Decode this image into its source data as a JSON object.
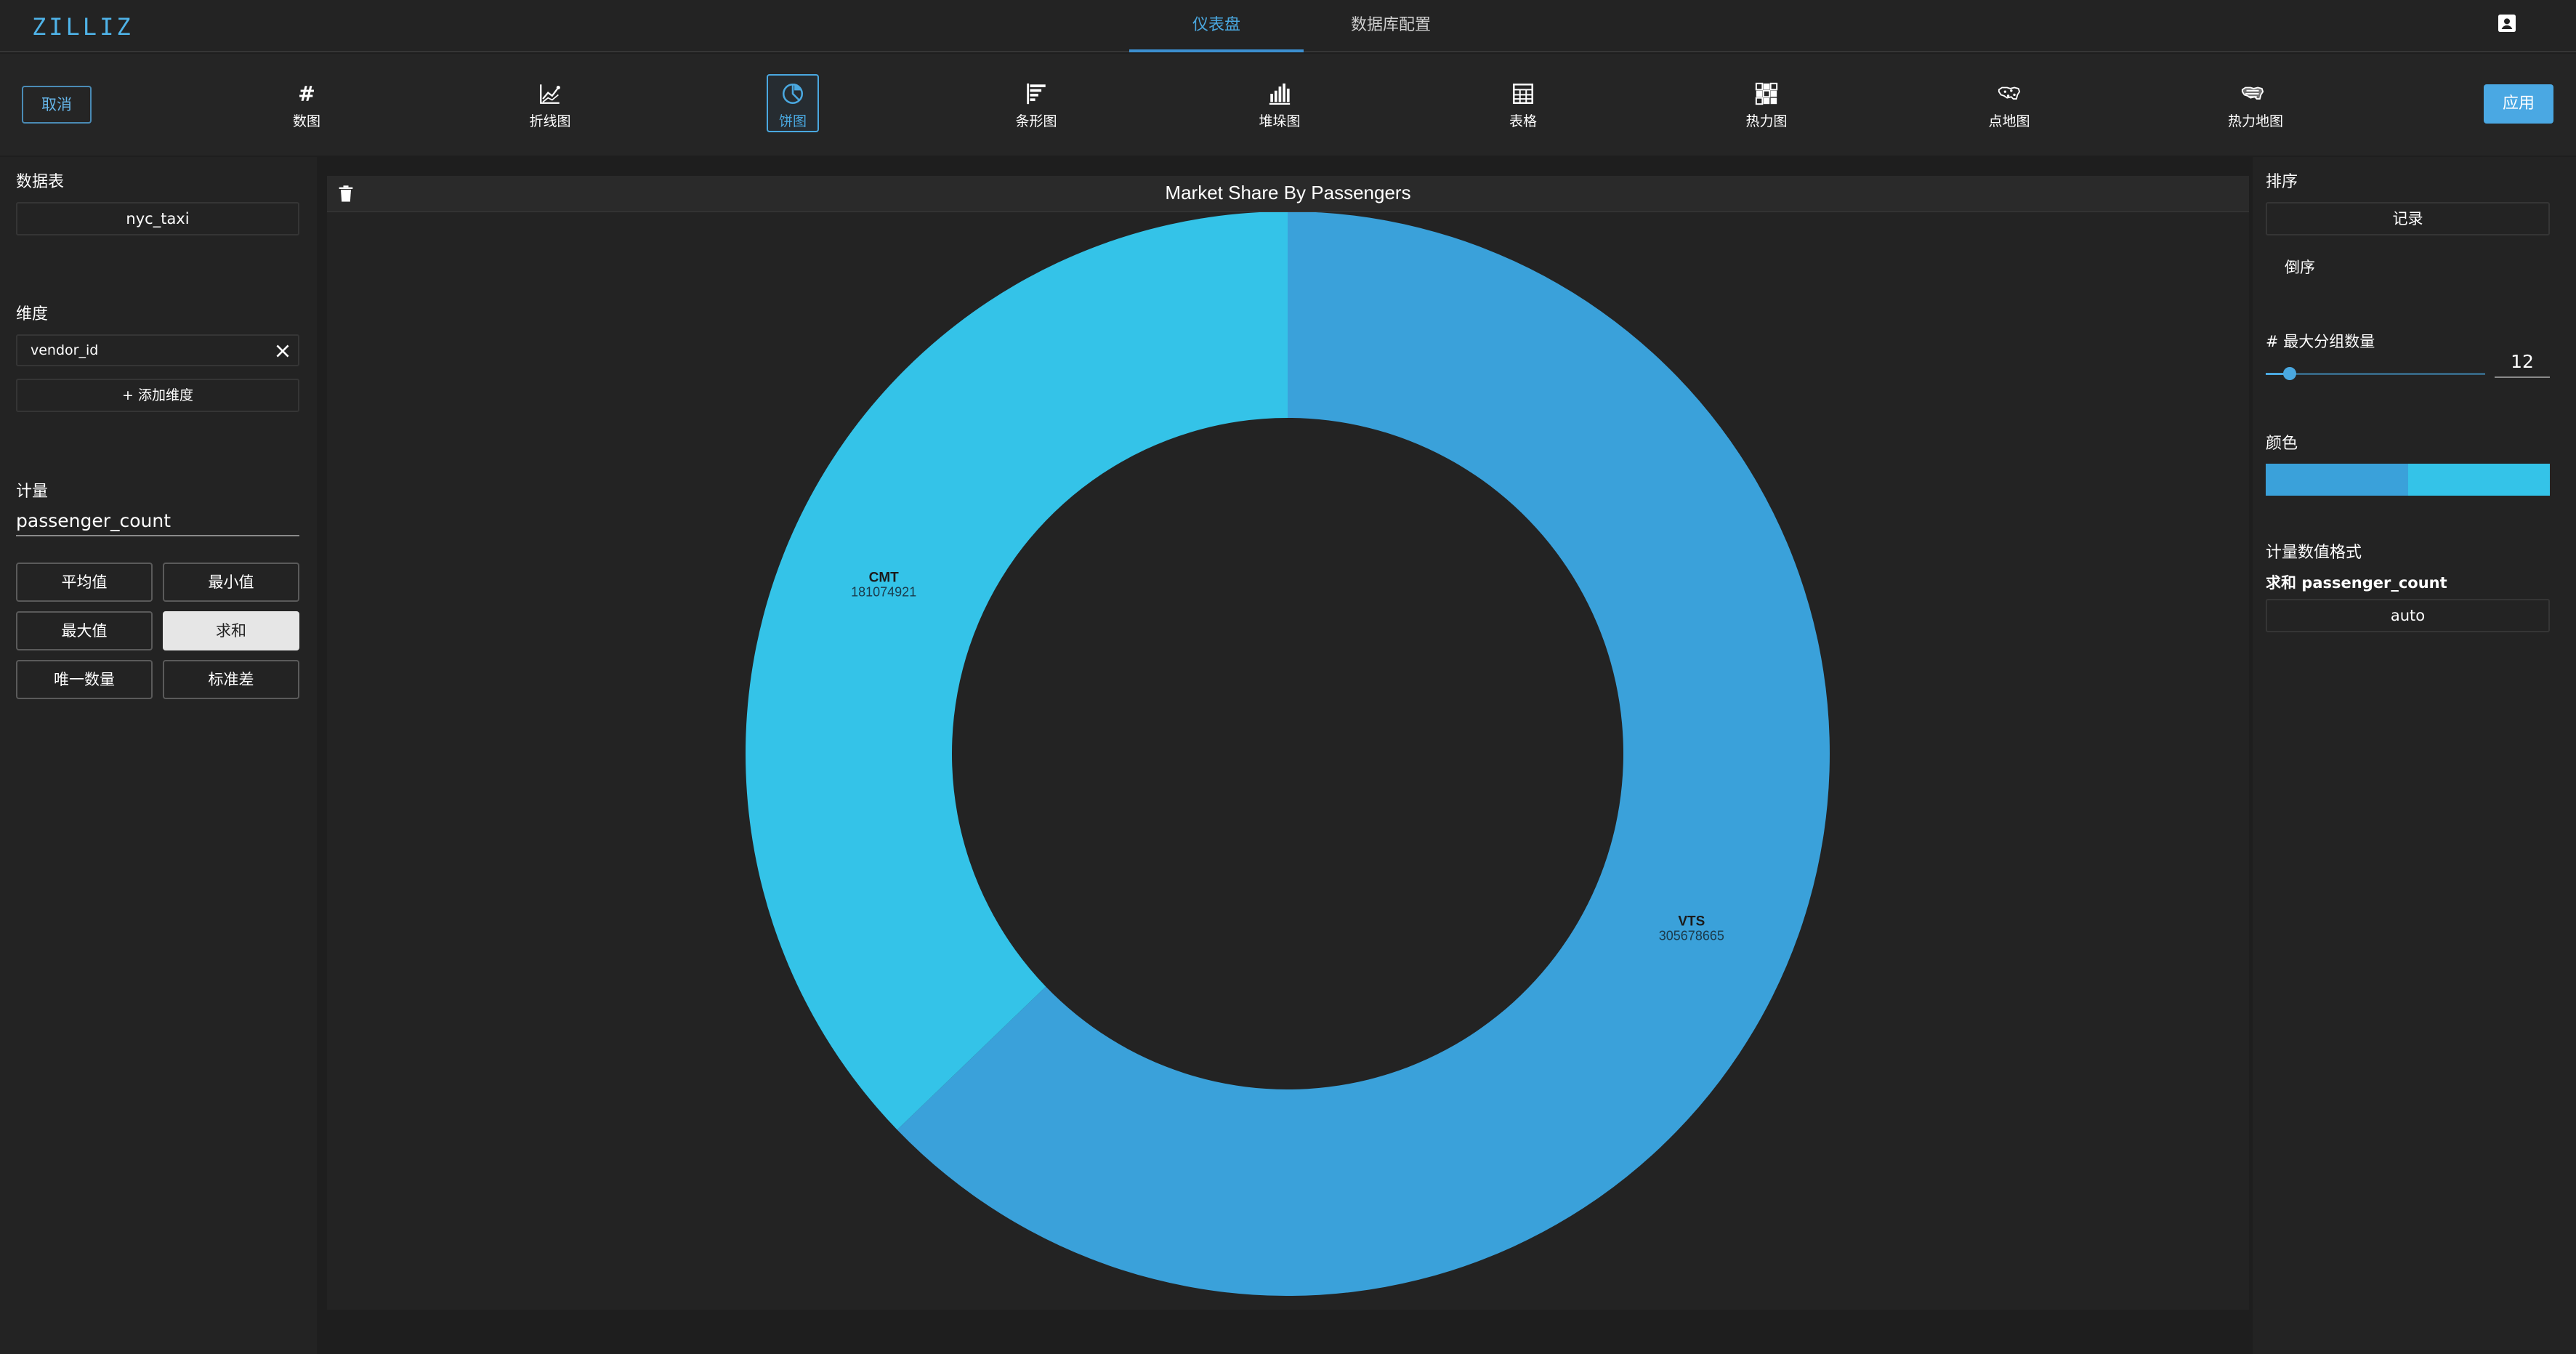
{
  "header": {
    "logo": "ZILLIZ",
    "tabs": [
      {
        "label": "仪表盘",
        "active": true
      },
      {
        "label": "数据库配置",
        "active": false
      }
    ],
    "user_icon": "account-box-icon"
  },
  "toolbar": {
    "cancel_label": "取消",
    "apply_label": "应用",
    "chart_types": [
      {
        "label": "数图",
        "icon": "hash-icon",
        "selected": false
      },
      {
        "label": "折线图",
        "icon": "line-chart-icon",
        "selected": false
      },
      {
        "label": "饼图",
        "icon": "pie-chart-icon",
        "selected": true
      },
      {
        "label": "条形图",
        "icon": "bar-chart-icon",
        "selected": false
      },
      {
        "label": "堆垛图",
        "icon": "stacked-chart-icon",
        "selected": false
      },
      {
        "label": "表格",
        "icon": "table-icon",
        "selected": false
      },
      {
        "label": "热力图",
        "icon": "heatmap-icon",
        "selected": false
      },
      {
        "label": "点地图",
        "icon": "point-map-icon",
        "selected": false
      },
      {
        "label": "热力地图",
        "icon": "heat-map-icon",
        "selected": false
      }
    ]
  },
  "left_panel": {
    "table_title": "数据表",
    "table_value": "nyc_taxi",
    "dimension_title": "维度",
    "dimension_value": "vendor_id",
    "add_dimension_label": "+ 添加维度",
    "measure_title": "计量",
    "measure_value": "passenger_count",
    "aggregations": [
      {
        "label": "平均值",
        "selected": false
      },
      {
        "label": "最小值",
        "selected": false
      },
      {
        "label": "最大值",
        "selected": false
      },
      {
        "label": "求和",
        "selected": true
      },
      {
        "label": "唯一数量",
        "selected": false
      },
      {
        "label": "标准差",
        "selected": false
      }
    ]
  },
  "chart": {
    "title": "Market Share By Passengers"
  },
  "chart_data": {
    "type": "pie",
    "title": "Market Share By Passengers",
    "donut": true,
    "categories": [
      "VTS",
      "CMT"
    ],
    "values": [
      305678665,
      181074921
    ],
    "colors": [
      "#3aa1da",
      "#34c3e8"
    ]
  },
  "right_panel": {
    "sort_title": "排序",
    "sort_value": "记录",
    "sort_order": "倒序",
    "max_groups_title": "# 最大分组数量",
    "max_groups_value": "12",
    "max_groups_fraction": 0.08,
    "color_title": "颜色",
    "colors": [
      "#3aa1da",
      "#34c3e8"
    ],
    "format_title": "计量数值格式",
    "format_measure": "求和 passenger_count",
    "format_value": "auto"
  }
}
